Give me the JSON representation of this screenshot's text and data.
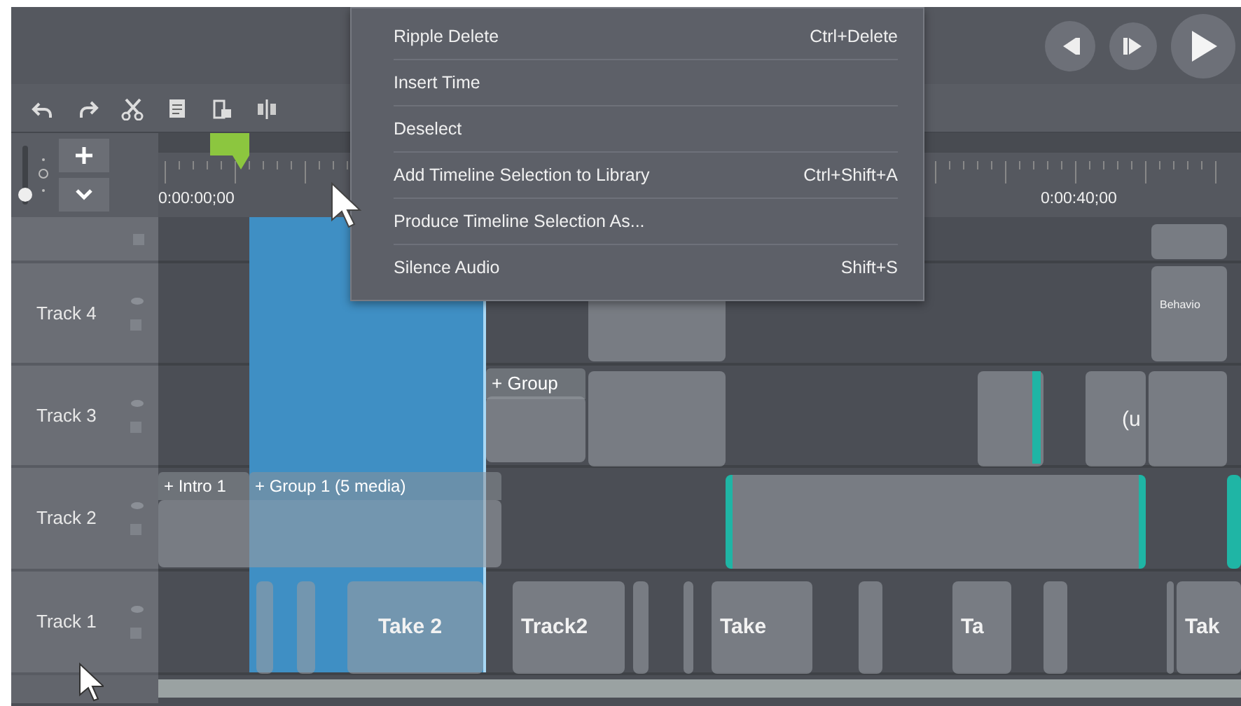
{
  "menu": {
    "items": [
      {
        "label": "Ripple Delete",
        "shortcut": "Ctrl+Delete"
      },
      {
        "label": "Insert Time"
      },
      {
        "label": "Deselect"
      },
      {
        "label": "Add Timeline Selection to Library",
        "shortcut": "Ctrl+Shift+A"
      },
      {
        "label": "Produce Timeline Selection As..."
      },
      {
        "label": "Silence Audio",
        "shortcut": "Shift+S"
      }
    ]
  },
  "zoom": {
    "level": 0.05
  },
  "ruler": {
    "timecodes": [
      "0:00:00;00",
      "0:00:40;00"
    ]
  },
  "tracks": [
    {
      "name": "Track 4",
      "clips": [
        {
          "label": "Behavio"
        }
      ]
    },
    {
      "name": "Track 3",
      "groups": [
        {
          "label": "+ Group"
        }
      ],
      "clips": [
        {
          "label": "(u"
        }
      ]
    },
    {
      "name": "Track 2",
      "groups": [
        {
          "label": "+ Intro 1"
        },
        {
          "label": "+ Group 1",
          "note": "(5 media)"
        }
      ]
    },
    {
      "name": "Track 1",
      "clips": [
        {
          "label": "Take 2"
        },
        {
          "label": "Track2"
        },
        {
          "label": "Take"
        },
        {
          "label": "Ta"
        },
        {
          "label": "Tak"
        }
      ]
    }
  ]
}
